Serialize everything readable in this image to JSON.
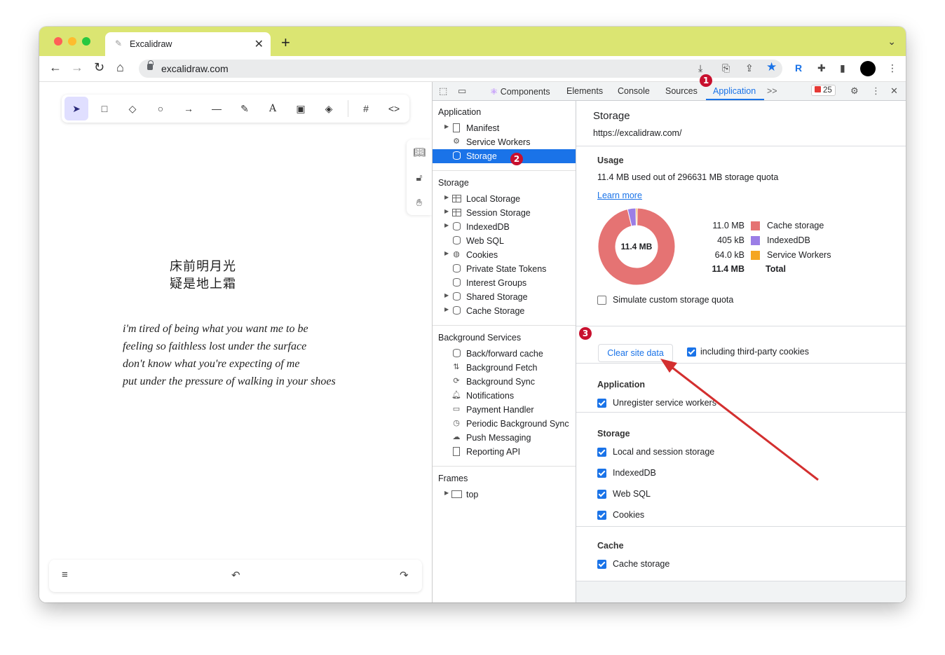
{
  "browser": {
    "tab_title": "Excalidraw",
    "tab_close": "✕",
    "new_tab": "+",
    "url": "excalidraw.com",
    "window_colors": {
      "close": "#ff5f57",
      "minimize": "#febc2e",
      "maximize": "#28c840",
      "tabstrip": "#dbe572"
    }
  },
  "excalidraw": {
    "tools": [
      "selection-tool",
      "rectangle-tool",
      "diamond-tool",
      "ellipse-tool",
      "arrow-tool",
      "line-tool",
      "draw-tool",
      "text-tool",
      "image-tool",
      "eraser-tool",
      "frame-tool",
      "embed-tool"
    ],
    "poem_cn": [
      "床前明月光",
      "疑是地上霜"
    ],
    "lyrics": [
      "i'm tired of being what you want me to be",
      "feeling so faithless lost under the surface",
      "don't know what you're expecting of me",
      "put under the pressure of walking in your shoes"
    ]
  },
  "devtools": {
    "tabs": [
      "Components",
      "Elements",
      "Console",
      "Sources",
      "Application"
    ],
    "active_tab": "Application",
    "more_tabs": ">>",
    "error_count": "25",
    "sidebar": {
      "application_header": "Application",
      "application_items": [
        "Manifest",
        "Service Workers",
        "Storage"
      ],
      "storage_header": "Storage",
      "storage_items": [
        "Local Storage",
        "Session Storage",
        "IndexedDB",
        "Web SQL",
        "Cookies",
        "Private State Tokens",
        "Interest Groups",
        "Shared Storage",
        "Cache Storage"
      ],
      "background_header": "Background Services",
      "background_items": [
        "Back/forward cache",
        "Background Fetch",
        "Background Sync",
        "Notifications",
        "Payment Handler",
        "Periodic Background Sync",
        "Push Messaging",
        "Reporting API"
      ],
      "frames_header": "Frames",
      "frames_items": [
        "top"
      ]
    },
    "storage_panel": {
      "title": "Storage",
      "origin": "https://excalidraw.com/",
      "usage_header": "Usage",
      "usage_text": "11.4 MB used out of 296631 MB storage quota",
      "learn_more": "Learn more",
      "donut_center": "11.4 MB",
      "breakdown": [
        {
          "value": "11.0 MB",
          "name": "Cache storage",
          "color": "#e57373",
          "fraction": 0.965
        },
        {
          "value": "405 kB",
          "name": "IndexedDB",
          "color": "#9b7ee6",
          "fraction": 0.035
        },
        {
          "value": "64.0 kB",
          "name": "Service Workers",
          "color": "#f5a623",
          "fraction": 0.006
        }
      ],
      "total_value": "11.4 MB",
      "total_label": "Total",
      "simulate_quota": "Simulate custom storage quota",
      "clear_button": "Clear site data",
      "third_party": "including third-party cookies",
      "application_section": "Application",
      "unregister_sw": "Unregister service workers",
      "storage_section": "Storage",
      "storage_checks": [
        "Local and session storage",
        "IndexedDB",
        "Web SQL",
        "Cookies"
      ],
      "cache_section": "Cache",
      "cache_checks": [
        "Cache storage"
      ]
    }
  },
  "annotations": {
    "step1": "1",
    "step2": "2",
    "step3": "3",
    "color": "#c8102e"
  }
}
